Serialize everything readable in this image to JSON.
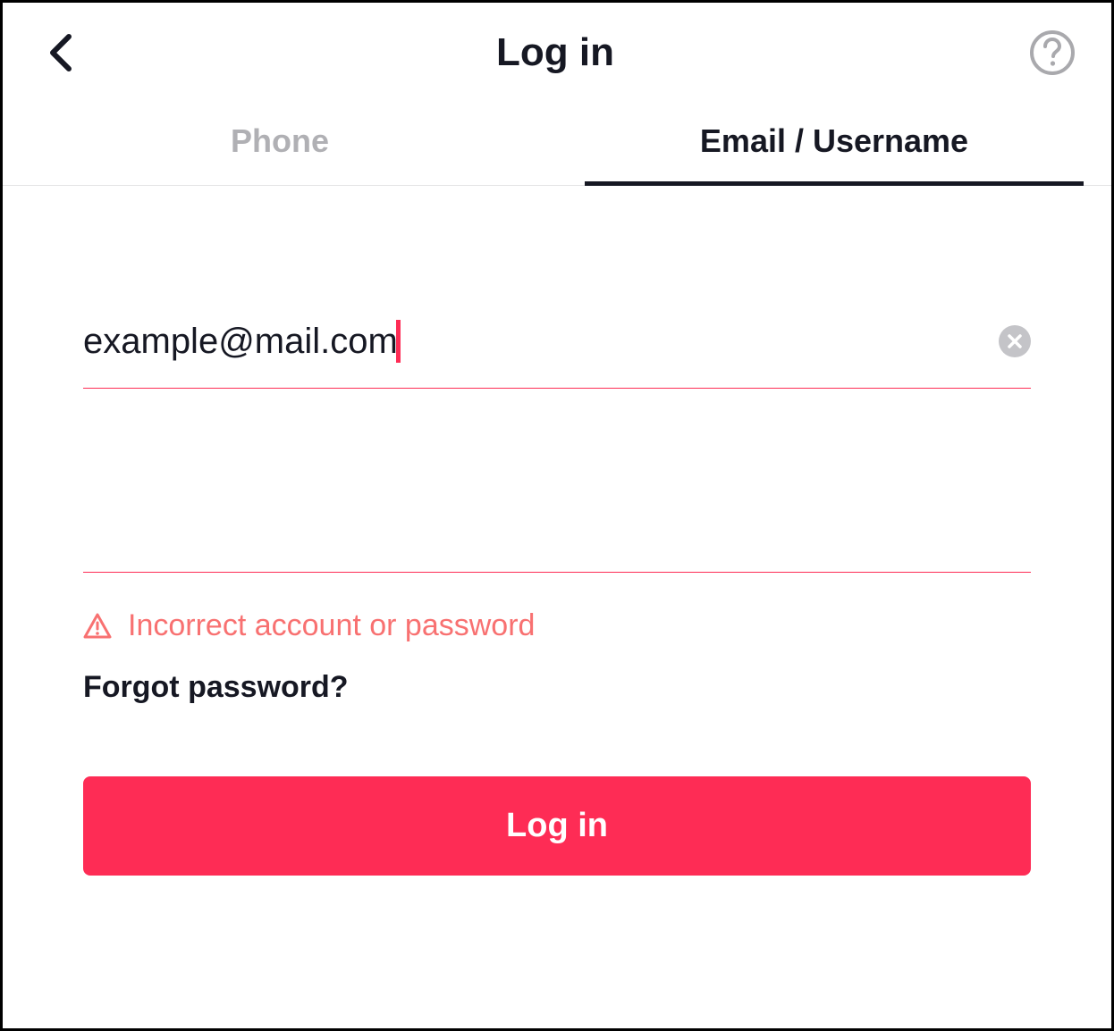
{
  "header": {
    "title": "Log in"
  },
  "tabs": {
    "phone": "Phone",
    "email": "Email / Username"
  },
  "form": {
    "email_value": "example@mail.com",
    "password_value": "",
    "error_message": "Incorrect account or password",
    "forgot_label": "Forgot password?",
    "login_button": "Log in"
  },
  "colors": {
    "accent": "#fe2c55",
    "text": "#161823",
    "muted": "#b0b0b4",
    "error": "#f87171"
  }
}
